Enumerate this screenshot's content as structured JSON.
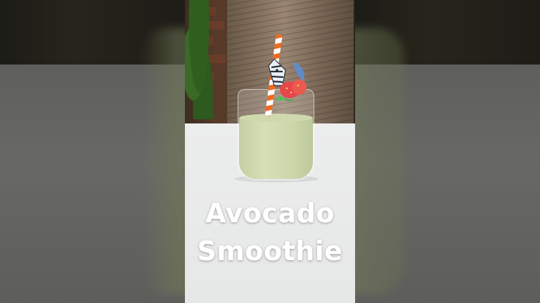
{
  "overlay": {
    "title_line1": "Avocado",
    "title_line2": "Smoothie"
  },
  "colors": {
    "smoothie": "#c6d19c",
    "straw": "#f26a21",
    "title": "#ffffff"
  },
  "icons": [
    "zebra-topper-icon",
    "strawberry-icon"
  ]
}
